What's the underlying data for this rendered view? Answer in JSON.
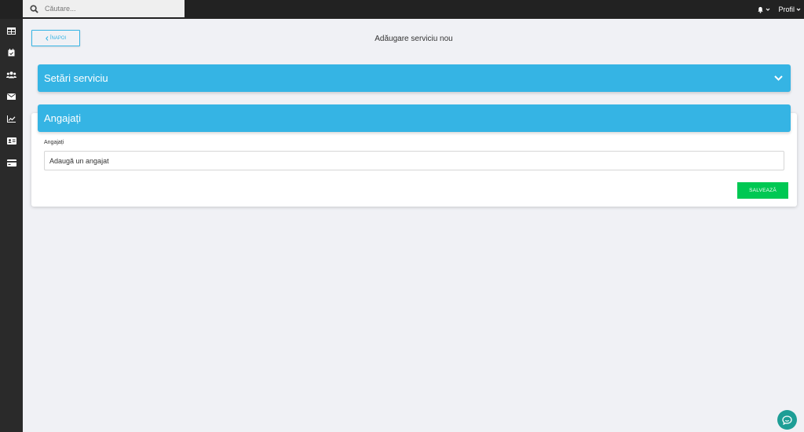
{
  "search": {
    "placeholder": "Căutare..."
  },
  "topbar": {
    "profile_label": "Profil"
  },
  "sidebar": {
    "items": [
      {
        "icon": "table-icon"
      },
      {
        "icon": "calendar-icon"
      },
      {
        "icon": "users-icon"
      },
      {
        "icon": "envelope-icon"
      },
      {
        "icon": "chart-icon"
      },
      {
        "icon": "id-card-icon"
      },
      {
        "icon": "credit-card-icon"
      }
    ]
  },
  "page": {
    "back_label": "ÎNAPOI",
    "title": "Adăugare serviciu nou"
  },
  "panels": {
    "settings_title": "Setări serviciu",
    "employees_title": "Angajați"
  },
  "employees": {
    "field_label": "Angajați",
    "input_placeholder": "Adaugă un angajat"
  },
  "actions": {
    "save_label": "SALVEAZĂ"
  },
  "colors": {
    "accent": "#35b4e4",
    "save": "#00c853",
    "chat": "#1e9e96",
    "topbar": "#222222",
    "sidebar": "#2a2a2a"
  }
}
